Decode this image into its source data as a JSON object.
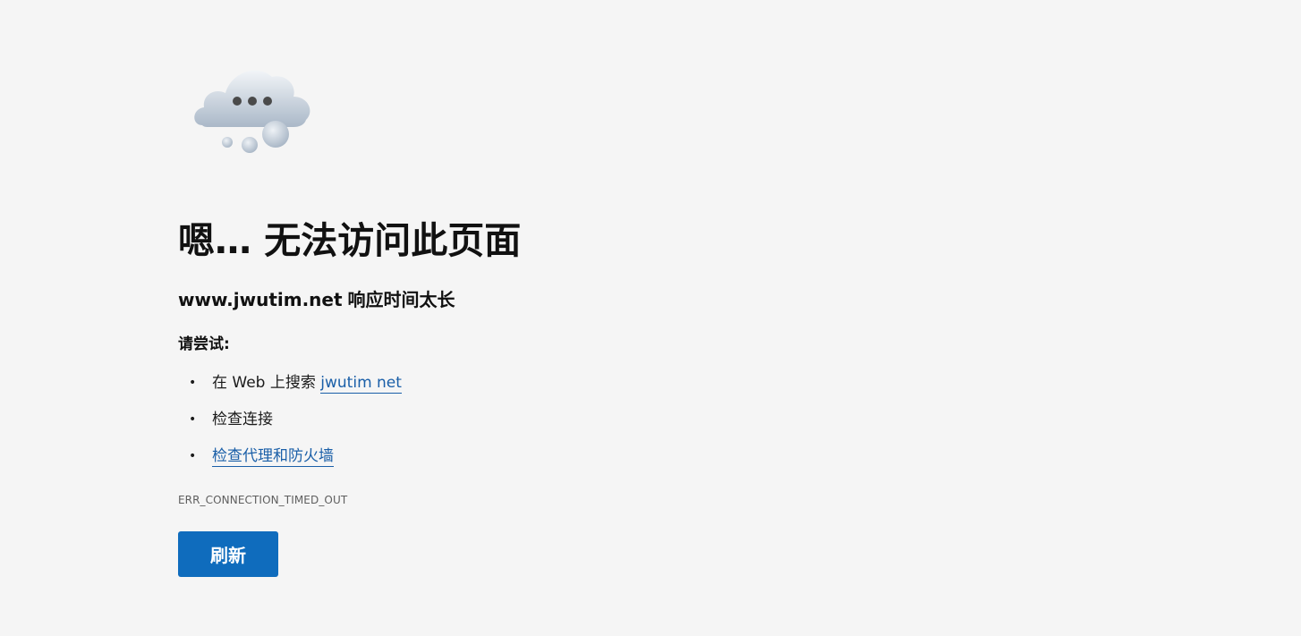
{
  "icon": "thinking-cloud-icon",
  "headline": "嗯… 无法访问此页面",
  "subheadline": {
    "host": "www.jwutim.net",
    "message": "响应时间太长"
  },
  "try_label": "请尝试:",
  "suggestions": {
    "search": {
      "prefix": "在 Web 上搜索",
      "link": "jwutim net"
    },
    "check_connection": "检查连接",
    "check_proxy": "检查代理和防火墙"
  },
  "error_code": "ERR_CONNECTION_TIMED_OUT",
  "refresh_label": "刷新",
  "colors": {
    "background": "#f5f5f5",
    "link": "#1a5fa8",
    "button": "#0f6cbd"
  }
}
